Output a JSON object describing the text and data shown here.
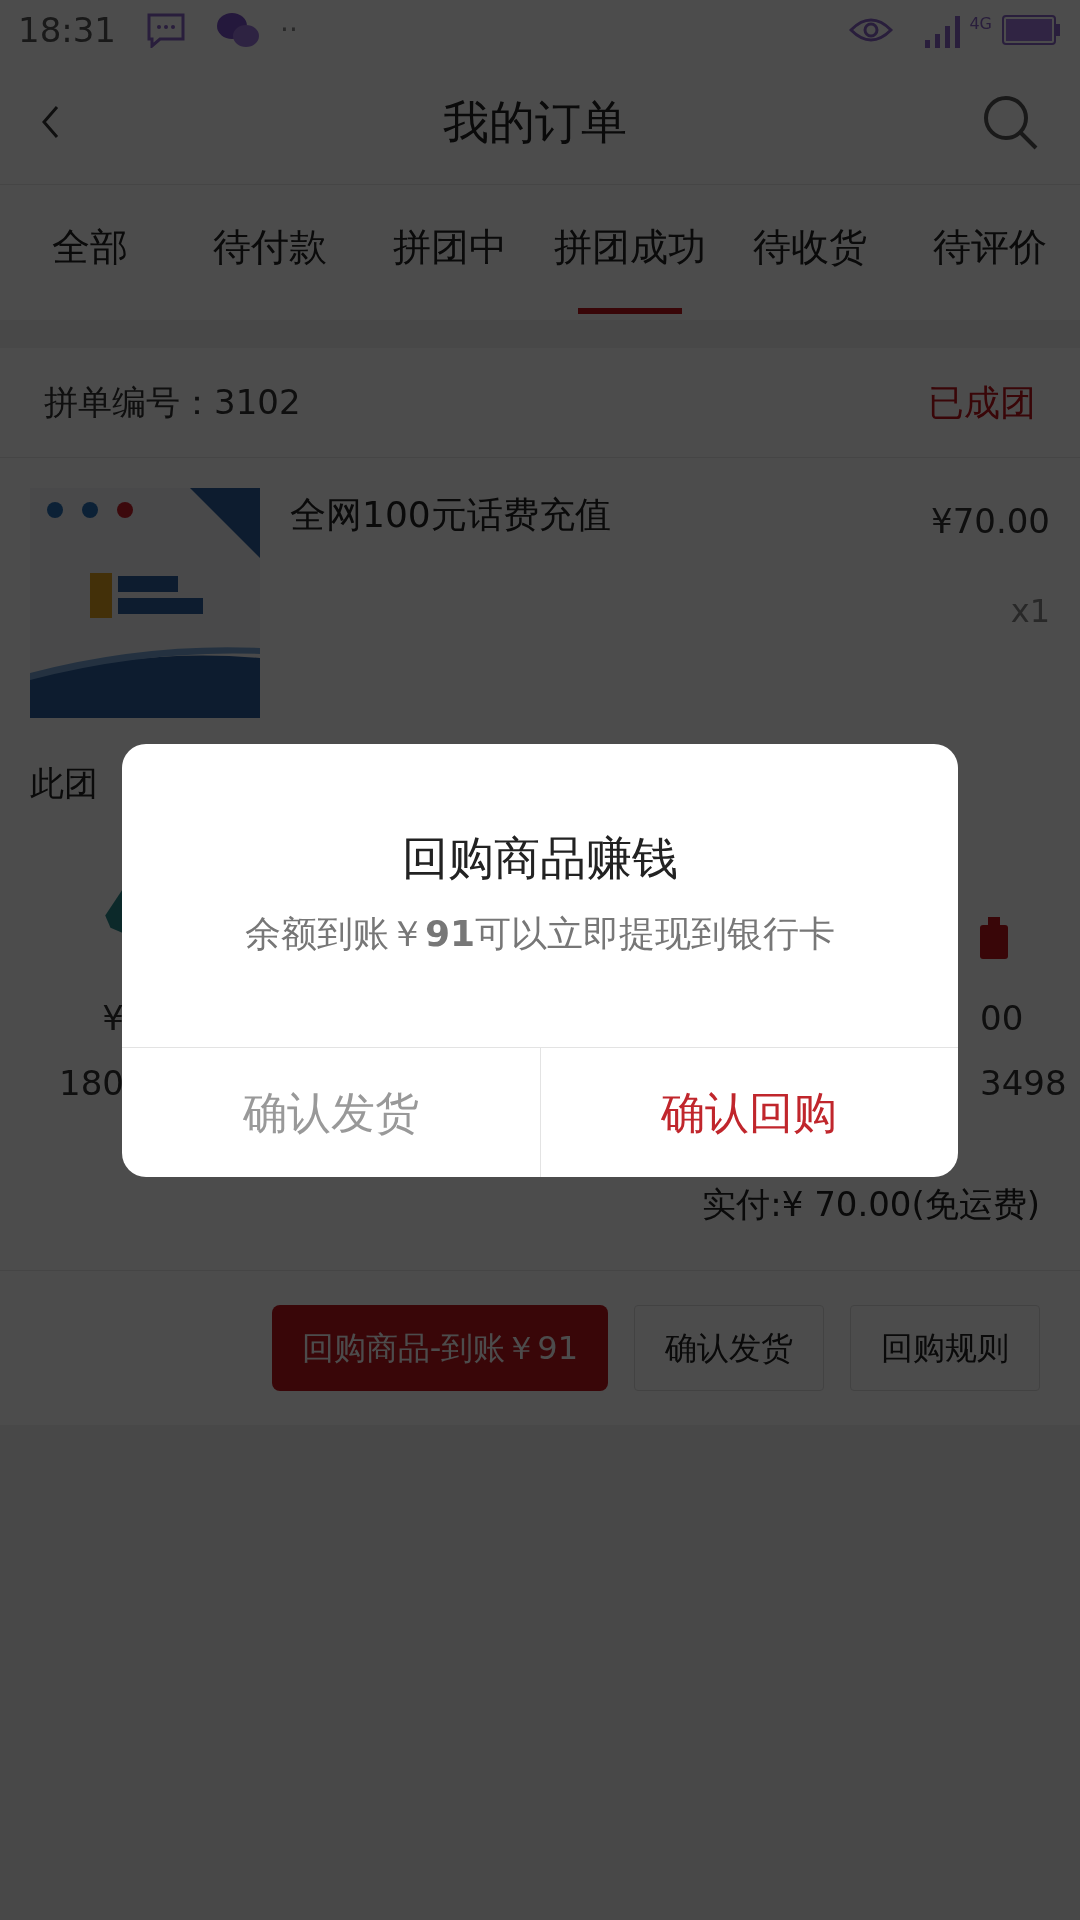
{
  "status_bar": {
    "time": "18:31",
    "more": "··",
    "network": "4G"
  },
  "header": {
    "title": "我的订单"
  },
  "tabs": [
    {
      "label": "全部",
      "selected": false
    },
    {
      "label": "待付款",
      "selected": false
    },
    {
      "label": "拼团中",
      "selected": false
    },
    {
      "label": "拼团成功",
      "selected": true
    },
    {
      "label": "待收货",
      "selected": false
    },
    {
      "label": "待评价",
      "selected": false
    }
  ],
  "order": {
    "number": "拼单编号：3102",
    "status": "已成团",
    "product": {
      "name": "全网100元话费充值",
      "price": "¥70.00",
      "quantity": "x1"
    },
    "group": {
      "label": "此团",
      "members": [
        {
          "price": "¥",
          "phone": "180"
        },
        {
          "price": "00",
          "phone": "3498"
        }
      ]
    },
    "total": "实付:¥ 70.00(免运费)"
  },
  "actions": [
    {
      "label": "回购商品-到账￥91",
      "kind": "primary"
    },
    {
      "label": "确认发货",
      "kind": "secondary"
    },
    {
      "label": "回购规则",
      "kind": "secondary"
    }
  ],
  "dialog": {
    "title": "回购商品赚钱",
    "message": "余额到账￥**91**可以立即提现到银行卡",
    "buttons": [
      {
        "label": "确认发货",
        "kind": "cancel"
      },
      {
        "label": "确认回购",
        "kind": "confirm"
      }
    ]
  }
}
